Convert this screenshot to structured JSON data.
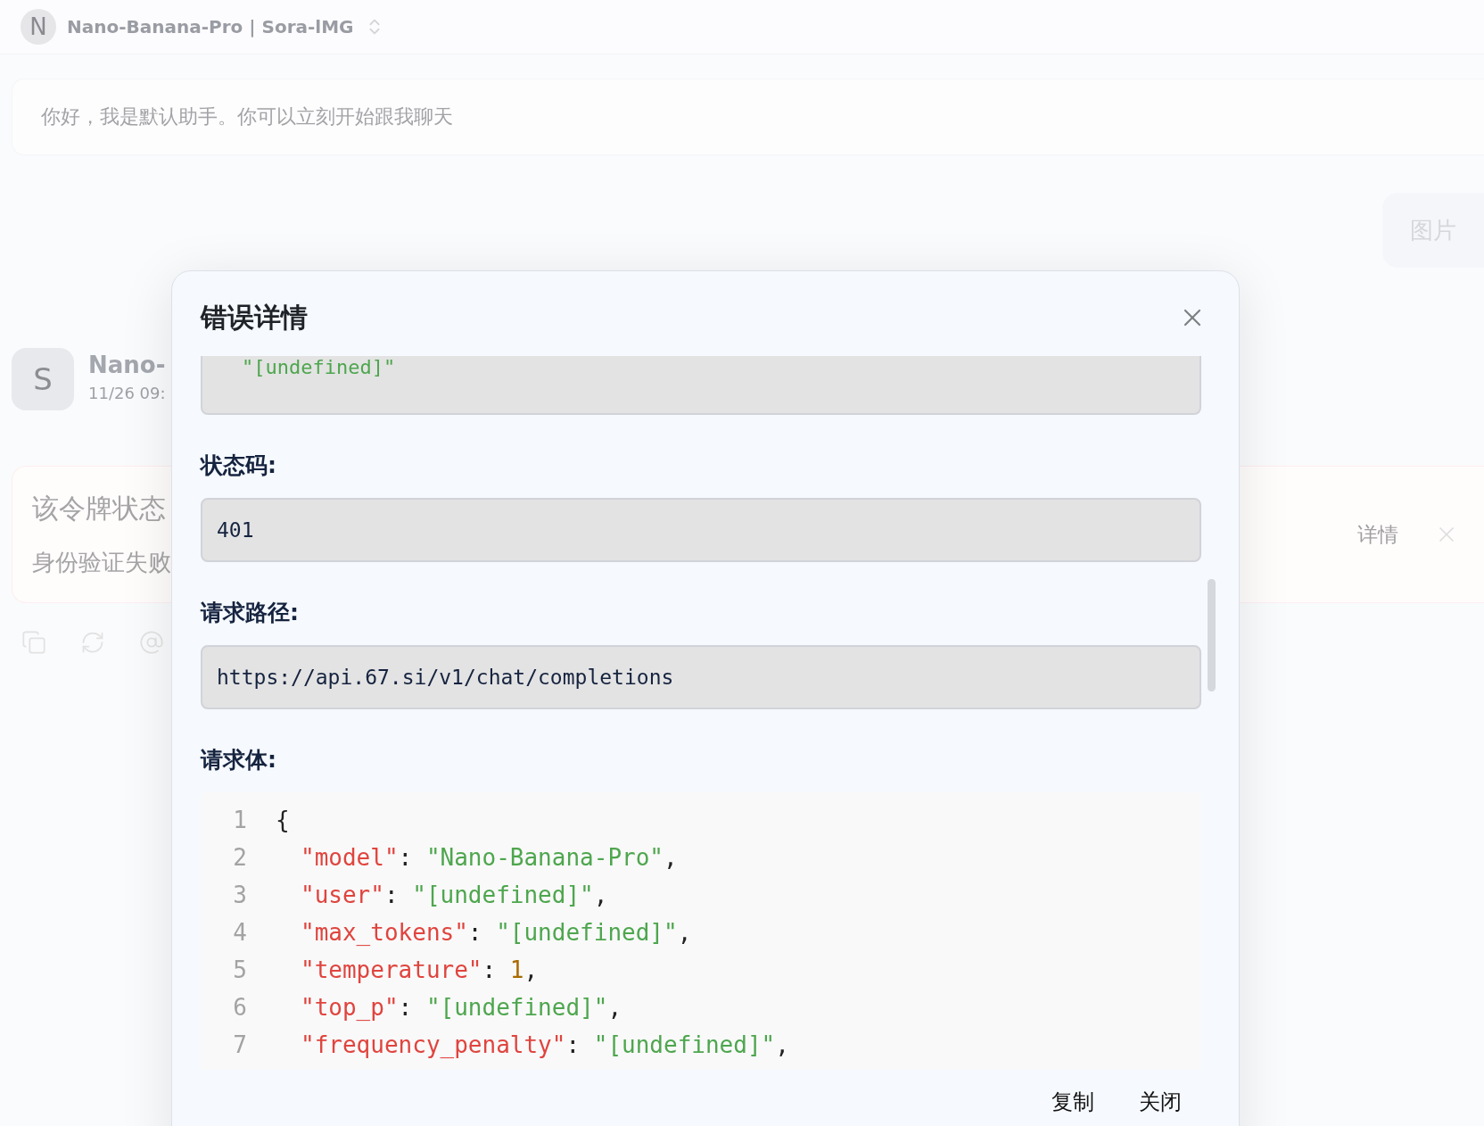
{
  "header": {
    "avatar_letter": "N",
    "title": "Nano-Banana-Pro | Sora-lMG"
  },
  "greeting": {
    "text": "你好，我是默认助手。你可以立刻开始跟我聊天"
  },
  "user_message": {
    "text": "图片"
  },
  "assistant": {
    "avatar_letter": "S",
    "name": "Nano-",
    "time": "11/26 09:"
  },
  "error_card": {
    "title": "该令牌状态",
    "message": "身份验证失败",
    "details_button": "详情"
  },
  "dialog": {
    "title": "错误详情",
    "cut_value": "\"[undefined]\"",
    "fields": [
      {
        "label": "状态码:",
        "value": "401"
      },
      {
        "label": "请求路径:",
        "value": "https://api.67.si/v1/chat/completions"
      }
    ],
    "body_label": "请求体:",
    "code_lines": [
      {
        "number": "1",
        "indent": false,
        "tokens": [
          {
            "kind": "punct",
            "text": "{"
          }
        ]
      },
      {
        "number": "2",
        "indent": true,
        "tokens": [
          {
            "kind": "key",
            "text": "\"model\""
          },
          {
            "kind": "punct",
            "text": ": "
          },
          {
            "kind": "string",
            "text": "\"Nano-Banana-Pro\""
          },
          {
            "kind": "punct",
            "text": ","
          }
        ]
      },
      {
        "number": "3",
        "indent": true,
        "tokens": [
          {
            "kind": "key",
            "text": "\"user\""
          },
          {
            "kind": "punct",
            "text": ": "
          },
          {
            "kind": "string",
            "text": "\"[undefined]\""
          },
          {
            "kind": "punct",
            "text": ","
          }
        ]
      },
      {
        "number": "4",
        "indent": true,
        "tokens": [
          {
            "kind": "key",
            "text": "\"max_tokens\""
          },
          {
            "kind": "punct",
            "text": ": "
          },
          {
            "kind": "string",
            "text": "\"[undefined]\""
          },
          {
            "kind": "punct",
            "text": ","
          }
        ]
      },
      {
        "number": "5",
        "indent": true,
        "tokens": [
          {
            "kind": "key",
            "text": "\"temperature\""
          },
          {
            "kind": "punct",
            "text": ": "
          },
          {
            "kind": "number",
            "text": "1"
          },
          {
            "kind": "punct",
            "text": ","
          }
        ]
      },
      {
        "number": "6",
        "indent": true,
        "tokens": [
          {
            "kind": "key",
            "text": "\"top_p\""
          },
          {
            "kind": "punct",
            "text": ": "
          },
          {
            "kind": "string",
            "text": "\"[undefined]\""
          },
          {
            "kind": "punct",
            "text": ","
          }
        ]
      },
      {
        "number": "7",
        "indent": true,
        "tokens": [
          {
            "kind": "key",
            "text": "\"frequency_penalty\""
          },
          {
            "kind": "punct",
            "text": ": "
          },
          {
            "kind": "string",
            "text": "\"[undefined]\""
          },
          {
            "kind": "punct",
            "text": ","
          }
        ]
      }
    ],
    "buttons": [
      "复制",
      "关闭"
    ]
  }
}
